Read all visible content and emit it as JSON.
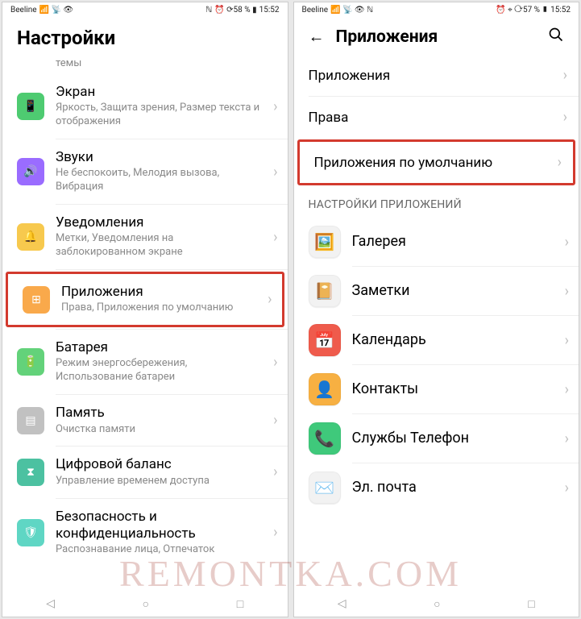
{
  "left": {
    "status": {
      "carrier": "Beeline",
      "icons_left": "📶 📡 👁",
      "nfc": "ℕ",
      "icons_right": "⏰ ⟳58 % ▮",
      "time": "15:52"
    },
    "title": "Настройки",
    "top_cut": "темы",
    "items": [
      {
        "icon": "📱",
        "bg": "bg-green",
        "title": "Экран",
        "sub": "Яркость, Защита зрения, Размер текста и отображения"
      },
      {
        "icon": "🔊",
        "bg": "bg-purple",
        "title": "Звуки",
        "sub": "Не беспокоить, Мелодия вызова, Вибрация"
      },
      {
        "icon": "🔔",
        "bg": "bg-yellow",
        "title": "Уведомления",
        "sub": "Метки, Уведомления на заблокированном экране"
      },
      {
        "icon": "⊞",
        "bg": "bg-orange",
        "title": "Приложения",
        "sub": "Права, Приложения по умолчанию",
        "hl": true
      },
      {
        "icon": "🔋",
        "bg": "bg-battery",
        "title": "Батарея",
        "sub": "Режим энергосбережения, Использование батареи"
      },
      {
        "icon": "▤",
        "bg": "bg-gray",
        "title": "Память",
        "sub": "Очистка памяти"
      },
      {
        "icon": "⧗",
        "bg": "bg-teal",
        "title": "Цифровой баланс",
        "sub": "Управление временем доступа"
      },
      {
        "icon": "🛡",
        "bg": "bg-cyan",
        "title": "Безопасность и конфиденциальность",
        "sub": "Распознавание лица, Отпечаток"
      }
    ]
  },
  "right": {
    "status": {
      "carrier": "Beeline",
      "icons_left": "📶 📡 👁 ℕ",
      "icons_right": "⏰ ⌖ ⟳57 % ▮",
      "time": "15:52"
    },
    "title": "Приложения",
    "top_links": [
      {
        "label": "Приложения"
      },
      {
        "label": "Права"
      },
      {
        "label": "Приложения по умолчанию",
        "hl": true
      }
    ],
    "section": "НАСТРОЙКИ ПРИЛОЖЕНИЙ",
    "apps": [
      {
        "emoji": "🖼️",
        "label": "Галерея"
      },
      {
        "emoji": "📔",
        "label": "Заметки"
      },
      {
        "emoji": "📅",
        "label": "Календарь",
        "iconbg": "#ef5b4c",
        "color": "#fff"
      },
      {
        "emoji": "👤",
        "label": "Контакты",
        "iconbg": "#f7b042",
        "color": "#fff"
      },
      {
        "emoji": "📞",
        "label": "Службы Телефон",
        "iconbg": "#3fc97b",
        "color": "#fff"
      },
      {
        "emoji": "✉️",
        "label": "Эл. почта"
      }
    ]
  },
  "watermark": "REMONTKA.COM"
}
